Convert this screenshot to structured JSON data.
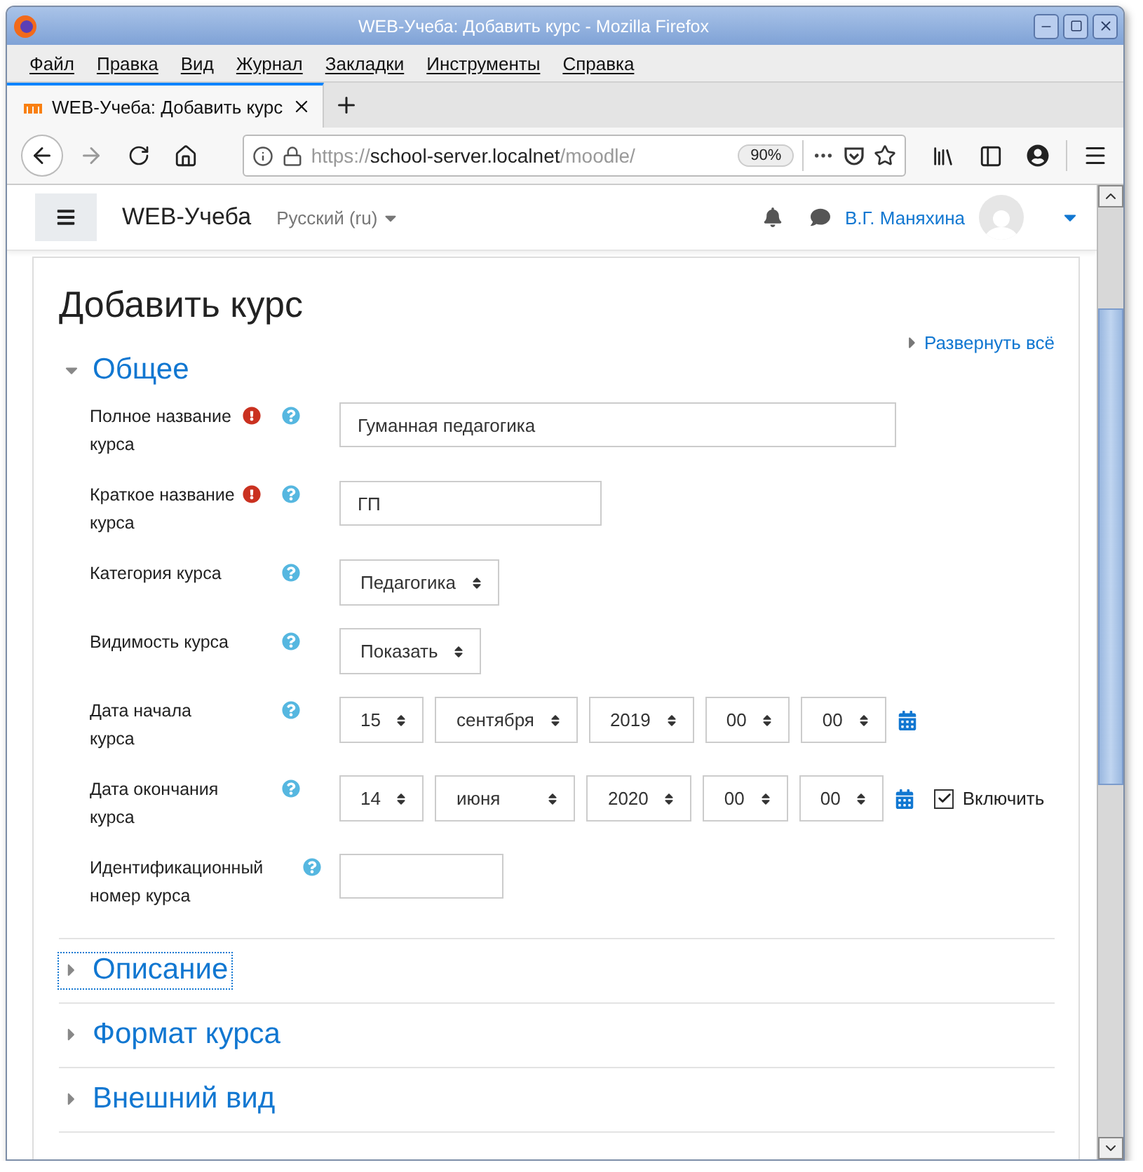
{
  "window": {
    "title": "WEB-Учеба: Добавить курс - Mozilla Firefox"
  },
  "menu": [
    "Файл",
    "Правка",
    "Вид",
    "Журнал",
    "Закладки",
    "Инструменты",
    "Справка"
  ],
  "tabs": [
    {
      "label": "WEB-Учеба: Добавить курс",
      "selected": true
    }
  ],
  "address": {
    "scheme": "https://",
    "host": "school-server.localnet",
    "path": "/moodle/",
    "zoom": "90%"
  },
  "navbar": {
    "site_name": "WEB-Учеба",
    "language": "Русский (ru)",
    "user": "В.Г. Маняхина"
  },
  "page": {
    "heading": "Добавить курс",
    "expand_all": "Развернуть всё"
  },
  "sections": [
    {
      "title": "Общее",
      "expanded": true,
      "focused": false,
      "fields": [
        {
          "kind": "longtext",
          "label": "Полное название курса",
          "required": true,
          "value": "Гуманная педагогика"
        },
        {
          "kind": "text",
          "label": "Краткое название курса",
          "required": true,
          "value": "ГП"
        },
        {
          "kind": "select",
          "label": "Категория курса",
          "required": false,
          "value": "Педагогика"
        },
        {
          "kind": "select",
          "label": "Видимость курса",
          "required": false,
          "value": "Показать"
        },
        {
          "kind": "date",
          "label": "Дата начала курса",
          "required": false,
          "parts": [
            "15",
            "сентября",
            "2019",
            "00",
            "00"
          ]
        },
        {
          "kind": "date",
          "label": "Дата окончания курса",
          "required": false,
          "parts": [
            "14",
            "июня",
            "2020",
            "00",
            "00"
          ],
          "enable": {
            "label": "Включить",
            "checked": true
          }
        },
        {
          "kind": "shorttext",
          "label": "Идентификационный номер курса",
          "required": false
        }
      ]
    },
    {
      "title": "Описание",
      "expanded": false,
      "focused": true
    },
    {
      "title": "Формат курса",
      "expanded": false,
      "focused": false
    },
    {
      "title": "Внешний вид",
      "expanded": false,
      "focused": false
    }
  ]
}
